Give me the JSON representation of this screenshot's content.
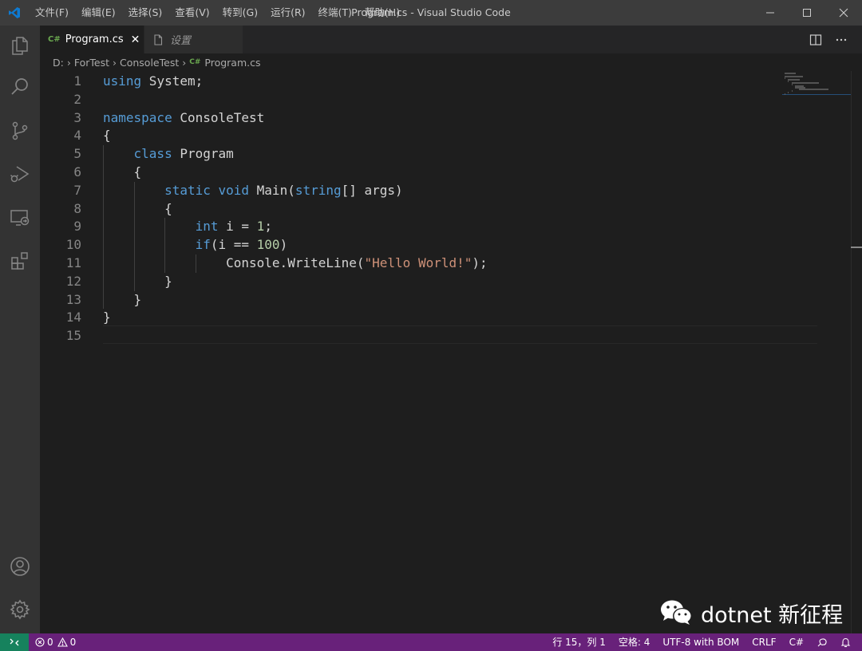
{
  "window": {
    "title": "Program.cs - Visual Studio Code"
  },
  "menu": [
    "文件(F)",
    "编辑(E)",
    "选择(S)",
    "查看(V)",
    "转到(G)",
    "运行(R)",
    "终端(T)",
    "帮助(H)"
  ],
  "tabs": [
    {
      "label": "Program.cs",
      "icon": "csharp-icon",
      "active": true
    },
    {
      "label": "设置",
      "icon": "file-icon",
      "active": false
    }
  ],
  "breadcrumb": [
    "D:",
    "ForTest",
    "ConsoleTest",
    "Program.cs"
  ],
  "editor": {
    "line_numbers": [
      "1",
      "2",
      "3",
      "4",
      "5",
      "6",
      "7",
      "8",
      "9",
      "10",
      "11",
      "12",
      "13",
      "14",
      "15"
    ],
    "lines": [
      [
        {
          "t": "using",
          "c": "kw"
        },
        {
          "t": " System;",
          "c": ""
        }
      ],
      [],
      [
        {
          "t": "namespace",
          "c": "kw"
        },
        {
          "t": " ConsoleTest",
          "c": ""
        }
      ],
      [
        {
          "t": "{",
          "c": ""
        }
      ],
      [
        {
          "t": "    ",
          "c": ""
        },
        {
          "t": "class",
          "c": "kw"
        },
        {
          "t": " Program",
          "c": ""
        }
      ],
      [
        {
          "t": "    {",
          "c": ""
        }
      ],
      [
        {
          "t": "        ",
          "c": ""
        },
        {
          "t": "static",
          "c": "kw"
        },
        {
          "t": " ",
          "c": ""
        },
        {
          "t": "void",
          "c": "kw"
        },
        {
          "t": " Main(",
          "c": ""
        },
        {
          "t": "string",
          "c": "kw"
        },
        {
          "t": "[] args)",
          "c": ""
        }
      ],
      [
        {
          "t": "        {",
          "c": ""
        }
      ],
      [
        {
          "t": "            ",
          "c": ""
        },
        {
          "t": "int",
          "c": "kw"
        },
        {
          "t": " i = ",
          "c": ""
        },
        {
          "t": "1",
          "c": "num"
        },
        {
          "t": ";",
          "c": ""
        }
      ],
      [
        {
          "t": "            ",
          "c": ""
        },
        {
          "t": "if",
          "c": "kw"
        },
        {
          "t": "(i == ",
          "c": ""
        },
        {
          "t": "100",
          "c": "num"
        },
        {
          "t": ")",
          "c": ""
        }
      ],
      [
        {
          "t": "                Console.WriteLine(",
          "c": ""
        },
        {
          "t": "\"Hello World!\"",
          "c": "str"
        },
        {
          "t": ");",
          "c": ""
        }
      ],
      [
        {
          "t": "        }",
          "c": ""
        }
      ],
      [
        {
          "t": "    }",
          "c": ""
        }
      ],
      [
        {
          "t": "}",
          "c": ""
        }
      ],
      []
    ]
  },
  "statusbar": {
    "errors": "0",
    "warnings": "0",
    "cursor": "行 15，列 1",
    "indent": "空格: 4",
    "encoding": "UTF-8 with BOM",
    "eol": "CRLF",
    "language": "C#"
  },
  "watermark": {
    "text": "dotnet 新征程"
  },
  "colors": {
    "statusbar": "#68217a",
    "remote": "#16825d",
    "keyword": "#569cd6",
    "string": "#ce9178",
    "number": "#b5cea8"
  }
}
